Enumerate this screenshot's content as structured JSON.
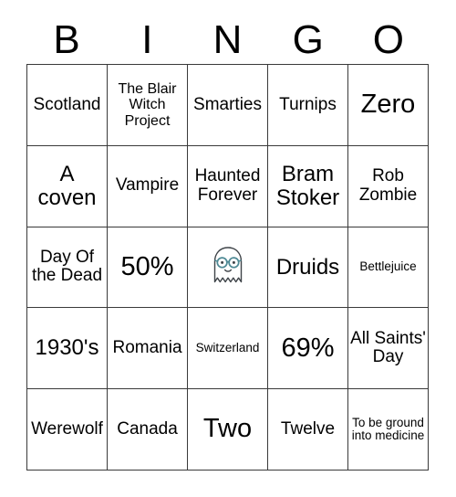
{
  "card": {
    "header_letters": [
      "B",
      "I",
      "N",
      "G",
      "O"
    ],
    "rows": [
      [
        {
          "text": "Scotland",
          "size": "md"
        },
        {
          "text": "The Blair Witch Project",
          "size": "sm"
        },
        {
          "text": "Smarties",
          "size": "md"
        },
        {
          "text": "Turnips",
          "size": "md"
        },
        {
          "text": "Zero",
          "size": "xl"
        }
      ],
      [
        {
          "text": "A coven",
          "size": "lg"
        },
        {
          "text": "Vampire",
          "size": "md"
        },
        {
          "text": "Haunted Forever",
          "size": "md"
        },
        {
          "text": "Bram Stoker",
          "size": "lg"
        },
        {
          "text": "Rob Zombie",
          "size": "md"
        }
      ],
      [
        {
          "text": "Day Of the Dead",
          "size": "md"
        },
        {
          "text": "50%",
          "size": "xl"
        },
        {
          "text": "",
          "size": "md",
          "icon": "ghost-icon"
        },
        {
          "text": "Druids",
          "size": "lg"
        },
        {
          "text": "Bettlejuice",
          "size": "xs"
        }
      ],
      [
        {
          "text": "1930's",
          "size": "lg"
        },
        {
          "text": "Romania",
          "size": "md"
        },
        {
          "text": "Switzerland",
          "size": "xs"
        },
        {
          "text": "69%",
          "size": "xl"
        },
        {
          "text": "All Saints' Day",
          "size": "md"
        }
      ],
      [
        {
          "text": "Werewolf",
          "size": "md"
        },
        {
          "text": "Canada",
          "size": "md"
        },
        {
          "text": "Two",
          "size": "xl"
        },
        {
          "text": "Twelve",
          "size": "md"
        },
        {
          "text": "To be ground into medicine",
          "size": "xs"
        }
      ]
    ],
    "free_space": {
      "icon": "ghost-icon",
      "glasses_color": "#4f8a95",
      "body_color": "#ffffff",
      "outline_color": "#3f4449"
    },
    "colors": {
      "grid_line": "#3a3a3a",
      "text": "#000000",
      "background": "#ffffff"
    }
  }
}
